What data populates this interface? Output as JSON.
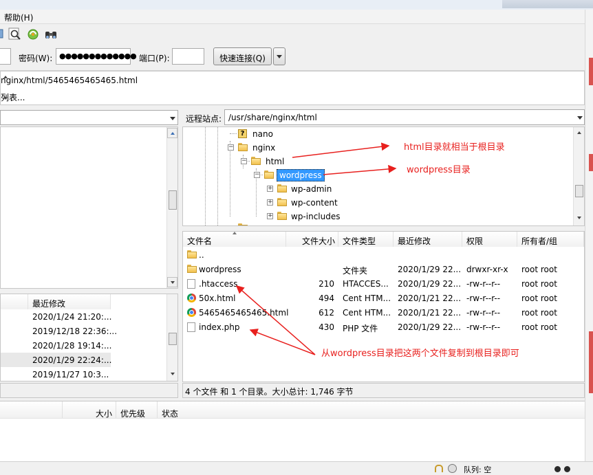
{
  "menu": {
    "help": "帮助(H)"
  },
  "quickconnect": {
    "password_label": "密码(W):",
    "password_value": "●●●●●●●●●●●●●",
    "port_label": "端口(P):",
    "port_value": "",
    "connect_button": "快速连接(Q)"
  },
  "log": {
    "lines": [
      "nginx/html/5465465465465.html",
      "列表..."
    ]
  },
  "remote": {
    "site_label": "远程站点:",
    "path": "/usr/share/nginx/html",
    "tree": [
      {
        "label": "nano",
        "type": "unknown"
      },
      {
        "label": "nginx",
        "type": "folder"
      },
      {
        "label": "html",
        "type": "folder"
      },
      {
        "label": "wordpress",
        "type": "folder",
        "selected": true
      },
      {
        "label": "wp-admin",
        "type": "folder"
      },
      {
        "label": "wp-content",
        "type": "folder"
      },
      {
        "label": "wp-includes",
        "type": "folder"
      }
    ],
    "columns": [
      "文件名",
      "文件大小",
      "文件类型",
      "最近修改",
      "权限",
      "所有者/组"
    ],
    "files": [
      {
        "name": "..",
        "size": "",
        "type": "",
        "modified": "",
        "perm": "",
        "owner": "",
        "icon": "folder"
      },
      {
        "name": "wordpress",
        "size": "",
        "type": "文件夹",
        "modified": "2020/1/29 22...",
        "perm": "drwxr-xr-x",
        "owner": "root root",
        "icon": "folder"
      },
      {
        "name": ".htaccess",
        "size": "210",
        "type": "HTACCES...",
        "modified": "2020/1/29 22...",
        "perm": "-rw-r--r--",
        "owner": "root root",
        "icon": "file"
      },
      {
        "name": "50x.html",
        "size": "494",
        "type": "Cent HTM...",
        "modified": "2020/1/21 22...",
        "perm": "-rw-r--r--",
        "owner": "root root",
        "icon": "chrome"
      },
      {
        "name": "5465465465465.html",
        "size": "612",
        "type": "Cent HTM...",
        "modified": "2020/1/21 22...",
        "perm": "-rw-r--r--",
        "owner": "root root",
        "icon": "chrome"
      },
      {
        "name": "index.php",
        "size": "430",
        "type": "PHP 文件",
        "modified": "2020/1/29 22...",
        "perm": "-rw-r--r--",
        "owner": "root root",
        "icon": "file"
      }
    ],
    "status": "4 个文件 和 1 个目录。大小总计: 1,746 字节"
  },
  "local": {
    "column_modified": "最近修改",
    "dates": [
      "2020/1/24 21:20:...",
      "2019/12/18 22:36:...",
      "2020/1/28 19:14:...",
      "2020/1/29 22:24:...",
      "2019/11/27 10:3..."
    ]
  },
  "queue": {
    "columns": [
      "大小",
      "优先级",
      "状态"
    ],
    "footer": "队列: 空"
  },
  "annotations": {
    "html_root": "html目录就相当于根目录",
    "wordpress_dir": "wordpress目录",
    "copy_hint": "从wordpress目录把这两个文件复制到根目录即可"
  },
  "colors": {
    "annotation": "#e8201e",
    "selection": "#3399ff",
    "folder": "#f2c14e"
  }
}
